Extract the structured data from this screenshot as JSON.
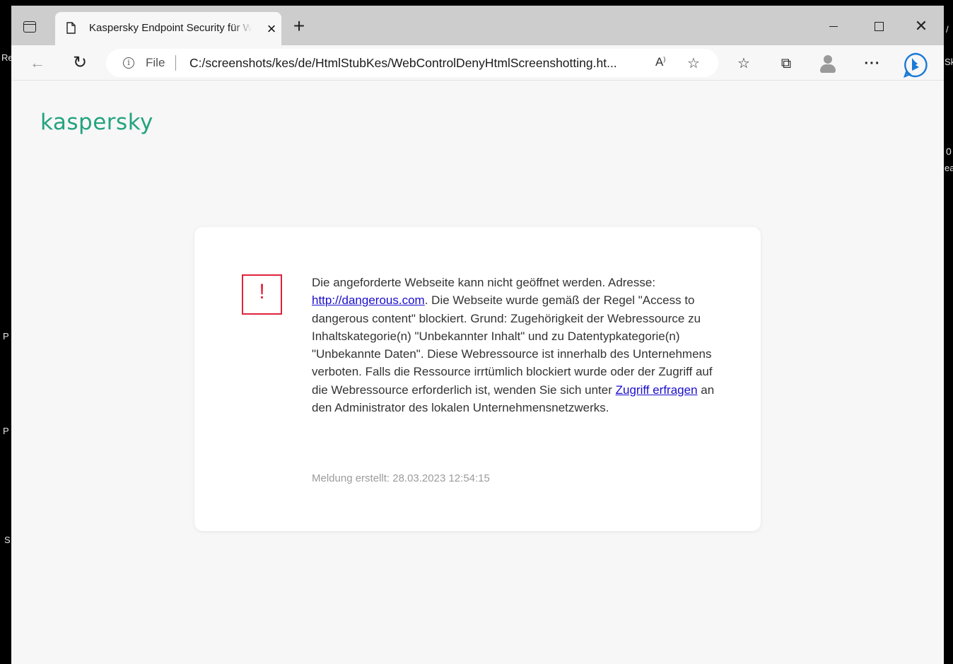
{
  "background_fragments": [
    "Re",
    "0",
    "ea",
    "P",
    "P",
    "S",
    "/",
    "Sk"
  ],
  "browser": {
    "tab": {
      "title": "Kaspersky Endpoint Security für Windows"
    },
    "address_bar": {
      "scheme_label": "File",
      "url": "C:/screenshots/kes/de/HtmlStubKes/WebControlDenyHtmlScreenshotting.ht..."
    }
  },
  "page": {
    "logo_text": "kaspersky",
    "brand_color": "#23a37f",
    "warning_color": "#e0223c",
    "warning_symbol": "!",
    "message": {
      "part1": "Die angeforderte Webseite kann nicht geöffnet werden. Adresse: ",
      "link_url_text": "http://dangerous.com",
      "part2": ". Die Webseite wurde gemäß der Regel \"Access to dangerous content\" blockiert. Grund: Zugehörigkeit der Webressource zu Inhaltskategorie(n) \"Unbekannter Inhalt\" und zu Datentypkategorie(n) \"Unbekannte Daten\". Diese Webressource ist innerhalb des Unternehmens verboten. Falls die Ressource irrtümlich blockiert wurde oder der Zugriff auf die Webressource erforderlich ist, wenden Sie sich unter ",
      "request_link_text": "Zugriff erfragen",
      "part3": " an den Administrator des lokalen Unternehmensnetzwerks."
    },
    "created_label": "Meldung erstellt: 28.03.2023 12:54:15"
  }
}
